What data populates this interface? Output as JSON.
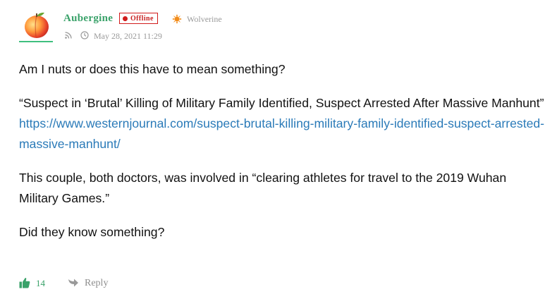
{
  "comment": {
    "author": "Aubergine",
    "status": "Offline",
    "rank": "Wolverine",
    "timestamp": "May 28, 2021 11:29",
    "paragraphs": [
      "Am I nuts or does this have to mean something?",
      "“Suspect in ‘Brutal’ Killing of Military Family Identified, Suspect Arrested After Massive Manhunt”",
      "This couple, both doctors, was involved in “clearing athletes for travel to the 2019 Wuhan Military Games.”",
      "Did they know something?"
    ],
    "link": "https://www.westernjournal.com/suspect-brutal-killing-military-family-identified-suspect-arrested-massive-manhunt/",
    "likes": "14",
    "reply_label": "Reply"
  },
  "colors": {
    "accent": "#3aa26a",
    "offline": "#d11b1b",
    "link": "#2a7ab8",
    "rank": "#f28c1a",
    "muted": "#9a9a9a"
  },
  "icons": {
    "avatar": "peach-avatar",
    "rank": "sun-badge-icon",
    "feed": "rss-icon",
    "time": "clock-icon",
    "like": "thumbs-up-icon",
    "reply": "reply-arrow-icon"
  }
}
